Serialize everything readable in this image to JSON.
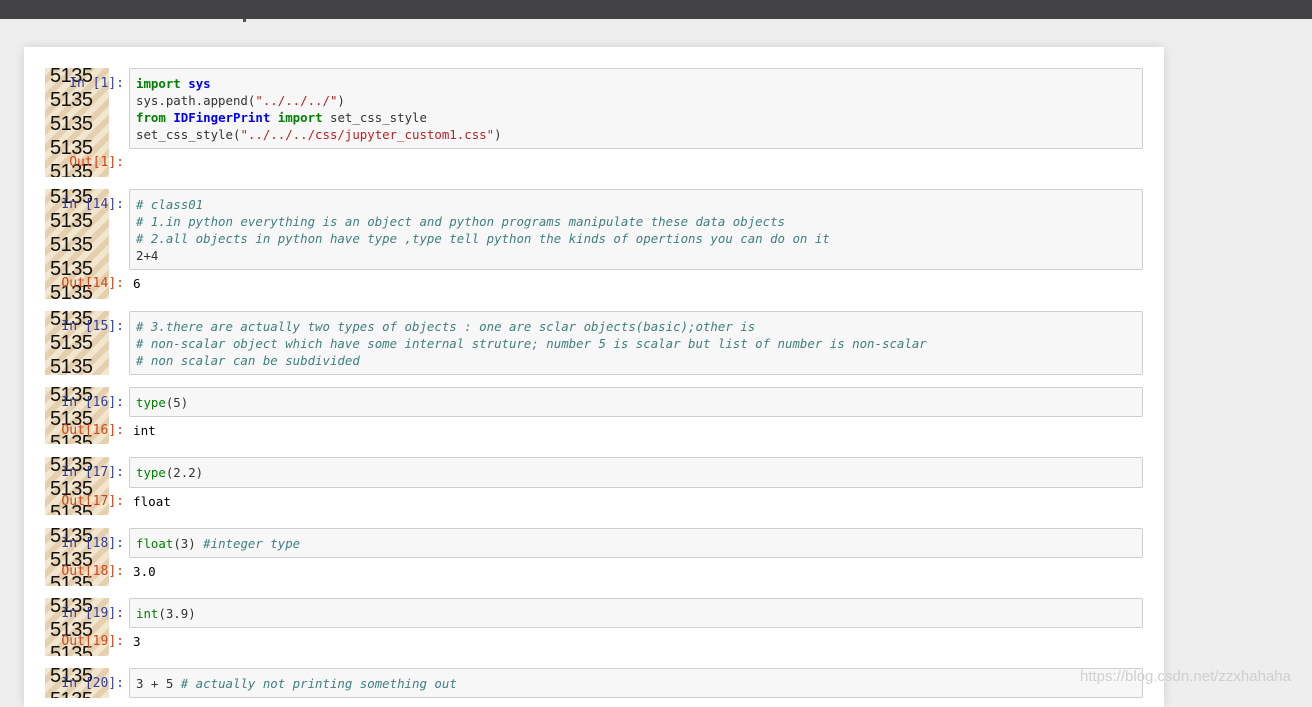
{
  "watermark": "5135",
  "site_watermark": "https://blog.csdn.net/zzxhahaha",
  "cells": [
    {
      "in_prompt": "In [1]:",
      "lines": [
        [
          {
            "t": "import",
            "c": "kw"
          },
          {
            "t": " "
          },
          {
            "t": "sys",
            "c": "mod"
          }
        ],
        [
          {
            "t": "sys.path.append("
          },
          {
            "t": "\"../../../\"",
            "c": "str"
          },
          {
            "t": ")"
          }
        ],
        [
          {
            "t": "from",
            "c": "kw"
          },
          {
            "t": " "
          },
          {
            "t": "IDFingerPrint",
            "c": "mod"
          },
          {
            "t": " "
          },
          {
            "t": "import",
            "c": "kw"
          },
          {
            "t": " set_css_style"
          }
        ],
        [
          {
            "t": "set_css_style("
          },
          {
            "t": "\"../../../css/jupyter_custom1.css\"",
            "c": "str"
          },
          {
            "t": ")"
          }
        ]
      ],
      "out_prompt": "Out[1]:",
      "output": ""
    },
    {
      "in_prompt": "In [14]:",
      "lines": [
        [
          {
            "t": "# class01",
            "c": "cm"
          }
        ],
        [
          {
            "t": "# 1.in python everything is an object and python programs manipulate these data objects",
            "c": "cm"
          }
        ],
        [
          {
            "t": "# 2.all objects in python have type ,type tell python the kinds of opertions you can do on it",
            "c": "cm"
          }
        ],
        [
          {
            "t": "2+4"
          }
        ]
      ],
      "out_prompt": "Out[14]:",
      "output": "6"
    },
    {
      "in_prompt": "In [15]:",
      "lines": [
        [
          {
            "t": "# 3.there are actually two types of objects : one are sclar objects(basic);other is",
            "c": "cm"
          }
        ],
        [
          {
            "t": "# non-scalar object which have some internal struture; number 5 is scalar but list of number is non-scalar",
            "c": "cm"
          }
        ],
        [
          {
            "t": "# non scalar can be subdivided",
            "c": "cm"
          }
        ]
      ],
      "out_prompt": "",
      "output": ""
    },
    {
      "in_prompt": "In [16]:",
      "lines": [
        [
          {
            "t": "type",
            "c": "bi"
          },
          {
            "t": "(5)"
          }
        ]
      ],
      "out_prompt": "Out[16]:",
      "output": "int"
    },
    {
      "in_prompt": "In [17]:",
      "lines": [
        [
          {
            "t": "type",
            "c": "bi"
          },
          {
            "t": "(2.2)"
          }
        ]
      ],
      "out_prompt": "Out[17]:",
      "output": "float"
    },
    {
      "in_prompt": "In [18]:",
      "lines": [
        [
          {
            "t": "float",
            "c": "bi"
          },
          {
            "t": "(3) "
          },
          {
            "t": "#integer type",
            "c": "cm"
          }
        ]
      ],
      "out_prompt": "Out[18]:",
      "output": "3.0"
    },
    {
      "in_prompt": "In [19]:",
      "lines": [
        [
          {
            "t": "int",
            "c": "bi"
          },
          {
            "t": "(3.9)"
          }
        ]
      ],
      "out_prompt": "Out[19]:",
      "output": "3"
    },
    {
      "in_prompt": "In [20]:",
      "lines": [
        [
          {
            "t": "3 + 5 "
          },
          {
            "t": "# actually not printing something out",
            "c": "cm"
          }
        ]
      ],
      "out_prompt": "",
      "output": ""
    }
  ]
}
